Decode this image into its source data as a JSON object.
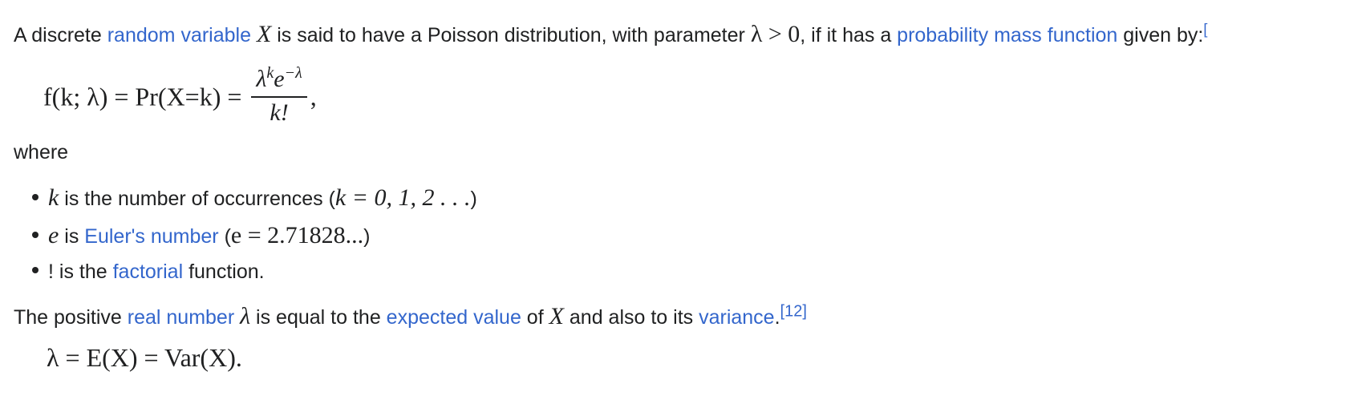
{
  "intro": {
    "p1": "A discrete ",
    "link_random_variable": "random variable",
    "var_X": "X",
    "p2": " is said to have a Poisson distribution, with parameter ",
    "lambda_gt_0": "λ > 0",
    "p3": ", if it has a ",
    "link_pmf": "probability mass function",
    "p4": " given by:",
    "cut_ref": "["
  },
  "formula1": {
    "lhs": "f(k; λ) = Pr(X=k) =",
    "num_lambda": "λ",
    "num_k": "k",
    "num_e": "e",
    "num_neg_lambda": "−λ",
    "den": "k!",
    "tail": ","
  },
  "where": "where",
  "bullets": [
    {
      "var": "k",
      "t1": " is the number of occurrences (",
      "math": "k = 0, 1, 2 . . .",
      "t2": ")"
    },
    {
      "var": "e",
      "t1": " is ",
      "link": "Euler's number",
      "t2": " (",
      "math": "e = 2.71828...",
      "t3": ")"
    },
    {
      "t1": "! is the ",
      "link": "factorial",
      "t2": " function."
    }
  ],
  "para2": {
    "p1": "The positive ",
    "link_real": "real number",
    "lambda": "λ",
    "p2": " is equal to the ",
    "link_expected": "expected value",
    "p3": " of ",
    "var_X": "X",
    "p4": " and also to its ",
    "link_variance": "variance",
    "p5": ".",
    "ref": "[12]"
  },
  "formula2": "λ = E(X) = Var(X)."
}
